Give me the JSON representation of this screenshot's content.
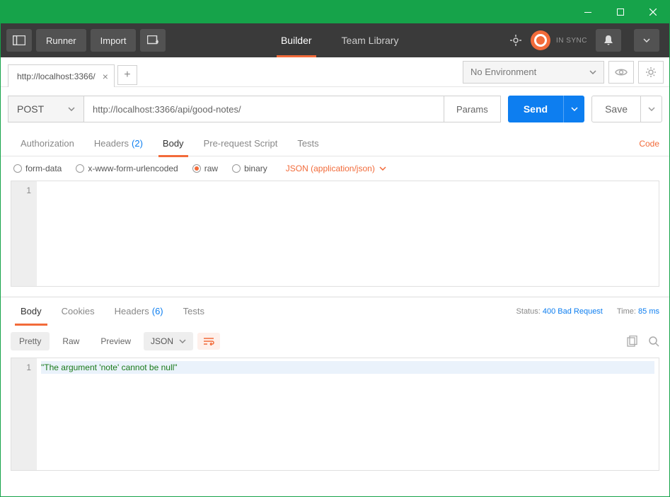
{
  "toolbar": {
    "runner": "Runner",
    "import": "Import",
    "tabs": {
      "builder": "Builder",
      "library": "Team Library"
    },
    "sync": "IN SYNC"
  },
  "env": {
    "selected": "No Environment",
    "tab_title": "http://localhost:3366/"
  },
  "request": {
    "method": "POST",
    "url": "http://localhost:3366/api/good-notes/",
    "params_btn": "Params",
    "send": "Send",
    "save": "Save",
    "subtabs": {
      "authorization": "Authorization",
      "headers": "Headers",
      "headers_count": "(2)",
      "body": "Body",
      "prerequest": "Pre-request Script",
      "tests": "Tests"
    },
    "code_link": "Code",
    "body_type": {
      "form_data": "form-data",
      "urlencoded": "x-www-form-urlencoded",
      "raw": "raw",
      "binary": "binary",
      "content_type": "JSON (application/json)"
    },
    "editor": {
      "line1_num": "1",
      "line1": ""
    }
  },
  "response": {
    "tabs": {
      "body": "Body",
      "cookies": "Cookies",
      "headers": "Headers",
      "headers_count": "(6)",
      "tests": "Tests"
    },
    "status_label": "Status:",
    "status_value": "400 Bad Request",
    "time_label": "Time:",
    "time_value": "85 ms",
    "views": {
      "pretty": "Pretty",
      "raw": "Raw",
      "preview": "Preview",
      "format": "JSON"
    },
    "editor": {
      "line1_num": "1",
      "line1": "\"The argument 'note' cannot be null\""
    }
  }
}
